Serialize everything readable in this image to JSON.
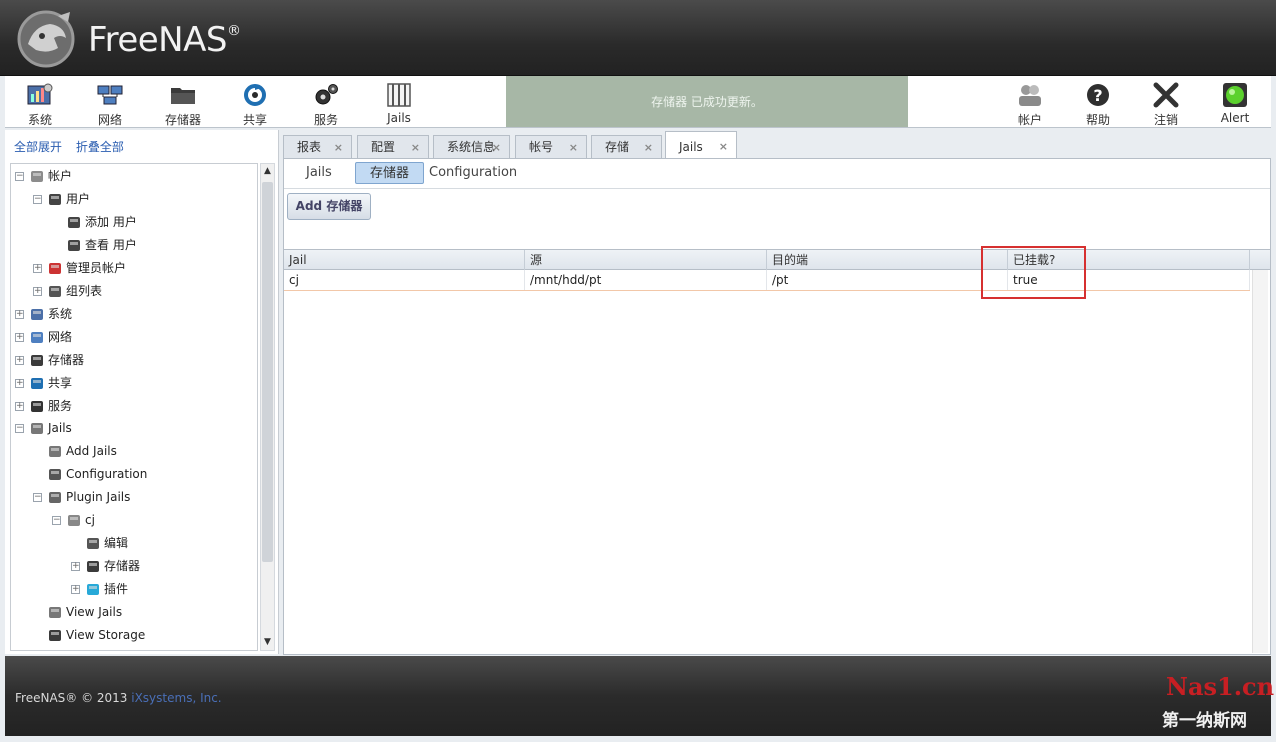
{
  "brand": {
    "name": "FreeNAS",
    "mark": "®"
  },
  "toolbar": {
    "left": [
      {
        "label": "系统",
        "icon": "system-icon"
      },
      {
        "label": "网络",
        "icon": "network-icon"
      },
      {
        "label": "存储器",
        "icon": "storage-icon"
      },
      {
        "label": "共享",
        "icon": "sharing-icon"
      },
      {
        "label": "服务",
        "icon": "services-icon"
      },
      {
        "label": "Jails",
        "icon": "jails-icon"
      }
    ],
    "status_message": "存储器 已成功更新。",
    "right": [
      {
        "label": "帐户",
        "icon": "account-icon"
      },
      {
        "label": "帮助",
        "icon": "help-icon"
      },
      {
        "label": "注销",
        "icon": "logout-icon"
      },
      {
        "label": "Alert",
        "icon": "alert-icon"
      }
    ]
  },
  "tree": {
    "expand_all": "全部展开",
    "collapse_all": "折叠全部",
    "nodes": [
      {
        "label": "帐户",
        "toggle": "−",
        "icon": "accounts-icon"
      },
      {
        "label": "用户",
        "toggle": "−",
        "icon": "user-icon"
      },
      {
        "label": "添加 用户",
        "icon": "add-user-icon"
      },
      {
        "label": "查看 用户",
        "icon": "view-user-icon"
      },
      {
        "label": "管理员帐户",
        "toggle": "+",
        "icon": "admin-icon"
      },
      {
        "label": "组列表",
        "toggle": "+",
        "icon": "group-icon"
      },
      {
        "label": "系统",
        "toggle": "+",
        "icon": "system-icon"
      },
      {
        "label": "网络",
        "toggle": "+",
        "icon": "network-icon"
      },
      {
        "label": "存储器",
        "toggle": "+",
        "icon": "storage-icon"
      },
      {
        "label": "共享",
        "toggle": "+",
        "icon": "sharing-icon"
      },
      {
        "label": "服务",
        "toggle": "+",
        "icon": "services-icon"
      },
      {
        "label": "Jails",
        "toggle": "−",
        "icon": "jails-icon"
      },
      {
        "label": "Add Jails",
        "icon": "add-jails-icon"
      },
      {
        "label": "Configuration",
        "icon": "wrench-icon"
      },
      {
        "label": "Plugin Jails",
        "toggle": "−",
        "icon": "plugin-jails-icon"
      },
      {
        "label": "cj",
        "toggle": "−",
        "icon": "jail-icon"
      },
      {
        "label": "编辑",
        "icon": "wrench-icon"
      },
      {
        "label": "存储器",
        "toggle": "+",
        "icon": "storage-icon"
      },
      {
        "label": "插件",
        "toggle": "+",
        "icon": "plugin-icon"
      },
      {
        "label": "View Jails",
        "icon": "view-jails-icon"
      },
      {
        "label": "View Storage",
        "icon": "view-storage-icon"
      }
    ]
  },
  "tabs": [
    {
      "label": "报表"
    },
    {
      "label": "配置"
    },
    {
      "label": "系统信息"
    },
    {
      "label": "帐号"
    },
    {
      "label": "存储"
    },
    {
      "label": "Jails",
      "active": true
    }
  ],
  "subtabs": [
    {
      "label": "Jails"
    },
    {
      "label": "存储器",
      "active": true
    },
    {
      "label": "Configuration"
    }
  ],
  "add_button": "Add 存储器",
  "grid": {
    "columns": [
      "Jail",
      "源",
      "目的端",
      "已挂载?"
    ],
    "rows": [
      [
        "cj",
        "/mnt/hdd/pt",
        "/pt",
        "true"
      ]
    ]
  },
  "footer": {
    "copyright": "FreeNAS® © 2013 ",
    "company": "iXsystems, Inc."
  },
  "watermark": {
    "line1": "Nas1.cn",
    "line2": "第一纳斯网"
  }
}
